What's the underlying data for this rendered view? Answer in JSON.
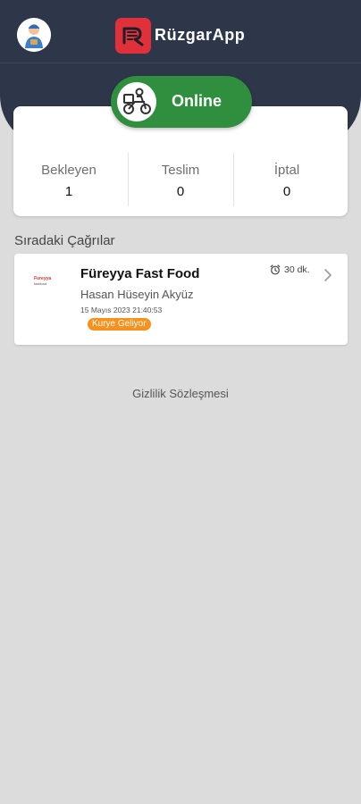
{
  "header": {
    "app_name": "RüzgarApp",
    "status_toggle_label": "Online"
  },
  "stats": [
    {
      "label": "Bekleyen",
      "value": "1"
    },
    {
      "label": "Teslim",
      "value": "0"
    },
    {
      "label": "İptal",
      "value": "0"
    }
  ],
  "queue": {
    "title": "Sıradaki Çağrılar",
    "orders": [
      {
        "restaurant_logo_text": "Fureyya",
        "restaurant_logo_subtext": "fastfood",
        "restaurant": "Füreyya Fast Food",
        "customer": "Hasan Hüseyin Akyüz",
        "datetime": "15 Mayıs 2023 21:40:53",
        "status": "Kurye Geliyor",
        "eta": "30 dk."
      }
    ]
  },
  "footer": {
    "privacy_link": "Gizlilik Sözleşmesi"
  },
  "colors": {
    "header_bg": "#2e3649",
    "online_green": "#2f8f3e",
    "logo_red": "#e0303a",
    "status_orange": "#f7921e",
    "page_bg": "#dcdcdc"
  },
  "icons": {
    "avatar": "courier-avatar",
    "logo": "ruzgar-logo-icon",
    "online": "courier-scooter-icon",
    "eta": "alarm-clock-icon",
    "chevron": "chevron-right-icon"
  }
}
